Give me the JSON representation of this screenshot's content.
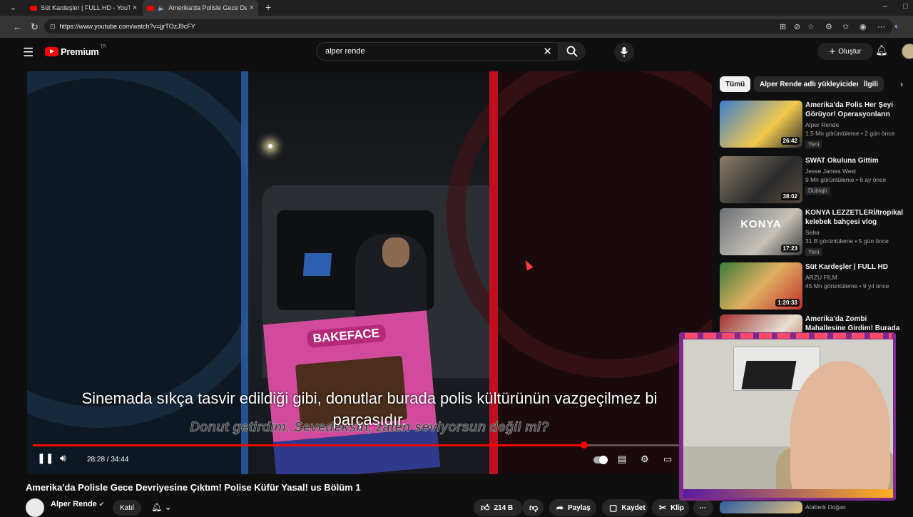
{
  "browser": {
    "tabs": [
      {
        "title": "Süt Kardeşler | FULL HD - YouTube",
        "active": false
      },
      {
        "title": "Amerika'da Polisle Gece Devriyesine Çıktım!",
        "active": true
      }
    ],
    "url": "https://www.youtube.com/watch?v=jjrTOzJ9cFY"
  },
  "header": {
    "brand": "Premium",
    "region": "TR",
    "search_query": "alper rende",
    "create_label": "Oluştur"
  },
  "player": {
    "subtitle_line1": "Sinemada sıkça tasvir edildiği gibi, donutlar burada polis kültürünün vazgeçilmez bi",
    "subtitle_line2": "parçasıdır.",
    "subtitle_overlay": "Donut getirdim. Sevedeksin, zaten seviyorsun değil mi?",
    "box_label": "BAKEFACE",
    "time_display": "28:28 / 34:44",
    "progress_fraction": 0.8186
  },
  "video": {
    "title": "Amerika'da Polisle Gece Devriyesine Çıktım! Polise Küfür Yasal! us Bölüm 1",
    "channel": "Alper Rende",
    "join_label": "Katıl",
    "likes": "214 B",
    "share_label": "Paylaş",
    "save_label": "Kaydet",
    "clip_label": "Klip"
  },
  "filters": {
    "chips": [
      "Tümü",
      "Alper Rende adlı yükleyiciden",
      "İlgili"
    ]
  },
  "recommendations": [
    {
      "title": "Amerika'da Polis Her Şeyi Görüyor! Operasyonların Perde...",
      "channel": "Alper Rende",
      "views": "1,5 Mn görüntüleme • 2 gün önce",
      "badge": "Yeni",
      "duration": "26:42"
    },
    {
      "title": "SWAT Okuluna Gittim",
      "channel": "Jesse James West",
      "views": "9 Mn görüntüleme • 6 ay önce",
      "badge": "Dublajlı",
      "duration": "38:02"
    },
    {
      "title": "KONYA LEZZETLERİ/tropikal kelebek bahçesi vlog",
      "channel": "Seha",
      "views": "31 B görüntüleme • 5 gün önce",
      "badge": "Yeni",
      "duration": "17:23",
      "thumb_text": "KONYA"
    },
    {
      "title": "Süt Kardeşler | FULL HD",
      "channel": "ARZU FİLM",
      "views": "45 Mn görüntüleme • 9 yıl önce",
      "badge": "",
      "duration": "1:20:33"
    },
    {
      "title": "Amerika'da Zombi Mahallesine Girdim! Burada Her Şey Yasal! ...",
      "channel": "",
      "views": "",
      "badge": "",
      "duration": ""
    },
    {
      "title": "",
      "channel": "Ataberk Doğan",
      "views": "",
      "badge": "",
      "duration": ""
    }
  ]
}
